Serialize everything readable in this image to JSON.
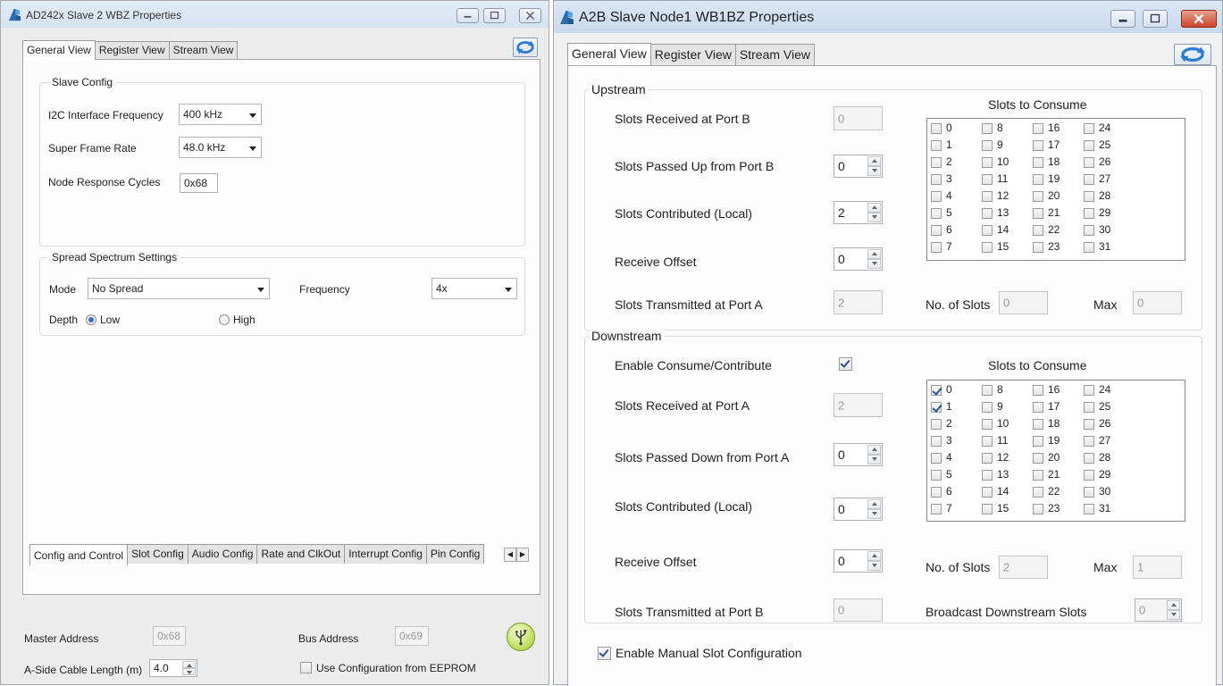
{
  "left_window": {
    "title": "AD242x Slave 2 WBZ Properties",
    "tabs": [
      "General View",
      "Register View",
      "Stream View"
    ],
    "slave_config": {
      "group_label": "Slave Config",
      "i2c_label": "I2C Interface Frequency",
      "i2c_value": "400 kHz",
      "sfr_label": "Super Frame Rate",
      "sfr_value": "48.0 kHz",
      "nrc_label": "Node Response Cycles",
      "nrc_value": "0x68"
    },
    "spread_spectrum": {
      "group_label": "Spread Spectrum Settings",
      "mode_label": "Mode",
      "mode_value": "No Spread",
      "freq_label": "Frequency",
      "freq_value": "4x",
      "depth_label": "Depth",
      "low_label": "Low",
      "high_label": "High"
    },
    "bottom_tabs": [
      "Config and Control",
      "Slot Config",
      "Audio Config",
      "Rate and ClkOut",
      "Interrupt Config",
      "Pin Config"
    ],
    "footer": {
      "master_label": "Master Address",
      "master_value": "0x68",
      "bus_label": "Bus Address",
      "bus_value": "0x69",
      "cable_label": "A-Side Cable Length (m)",
      "cable_value": "4.0",
      "eeprom_label": "Use Configuration from EEPROM"
    }
  },
  "right_window": {
    "title": "A2B Slave Node1 WB1BZ Properties",
    "tabs": [
      "General View",
      "Register View",
      "Stream View"
    ],
    "upstream": {
      "group_label": "Upstream",
      "slots_label": "Slots to Consume",
      "rx_label": "Slots Received at Port B",
      "rx_value": "0",
      "passed_label": "Slots Passed Up from Port B",
      "passed_value": "0",
      "contrib_label": "Slots Contributed (Local)",
      "contrib_value": "2",
      "offset_label": "Receive Offset",
      "offset_value": "0",
      "tx_label": "Slots Transmitted at Port A",
      "tx_value": "2",
      "nslots_label": "No. of Slots",
      "nslots_value": "0",
      "max_label": "Max",
      "max_value": "0",
      "checked_slots": []
    },
    "downstream": {
      "group_label": "Downstream",
      "enable_label": "Enable Consume/Contribute",
      "enable_checked": true,
      "slots_label": "Slots to Consume",
      "rx_label": "Slots Received at Port A",
      "rx_value": "2",
      "passed_label": "Slots Passed Down from Port A",
      "passed_value": "0",
      "contrib_label": "Slots Contributed (Local)",
      "contrib_value": "0",
      "offset_label": "Receive Offset",
      "offset_value": "0",
      "nslots_label": "No. of Slots",
      "nslots_value": "2",
      "max_label": "Max",
      "max_value": "1",
      "tx_label": "Slots Transmitted at Port B",
      "tx_value": "0",
      "broadcast_label": "Broadcast Downstream Slots",
      "broadcast_value": "0",
      "checked_slots": [
        0,
        1
      ]
    },
    "manual_label": "Enable Manual Slot Configuration",
    "manual_checked": true
  }
}
